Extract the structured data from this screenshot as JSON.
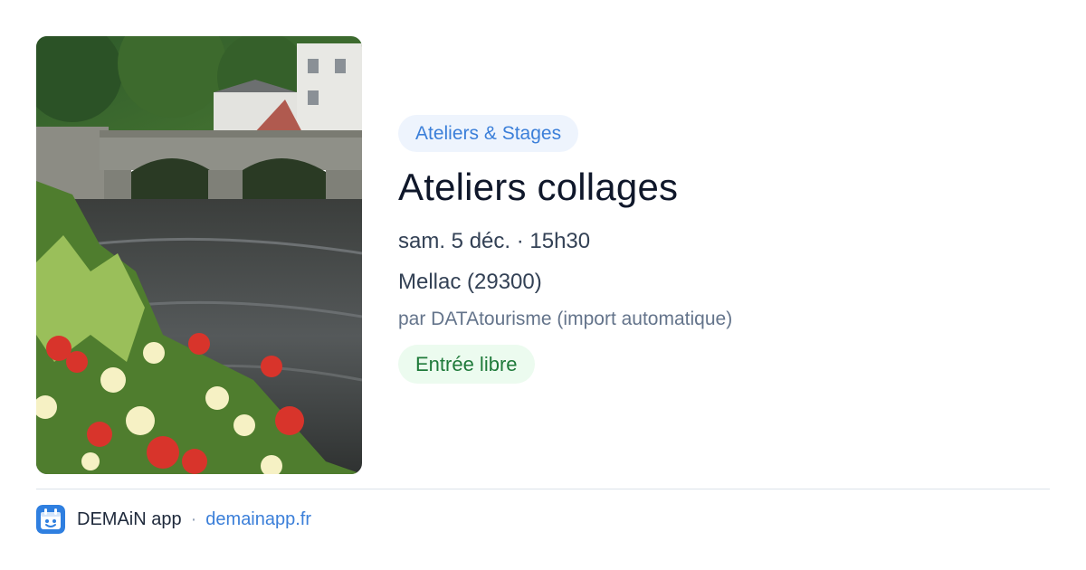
{
  "event": {
    "category": "Ateliers & Stages",
    "title": "Ateliers collages",
    "datetime": "sam. 5 déc. · 15h30",
    "location": "Mellac (29300)",
    "source": "par DATAtourisme (import automatique)",
    "price": "Entrée libre",
    "image": {
      "icon": "photo-river-bridge-flowers"
    }
  },
  "footer": {
    "app_name": "DEMAiN app",
    "separator": "·",
    "url": "demainapp.fr",
    "logo_icon": "demain-app-logo-icon"
  },
  "colors": {
    "accent": "#3b7fd9",
    "category_bg": "#eef4fd",
    "price_text": "#1f7a3a",
    "price_bg": "#ecfbef"
  }
}
